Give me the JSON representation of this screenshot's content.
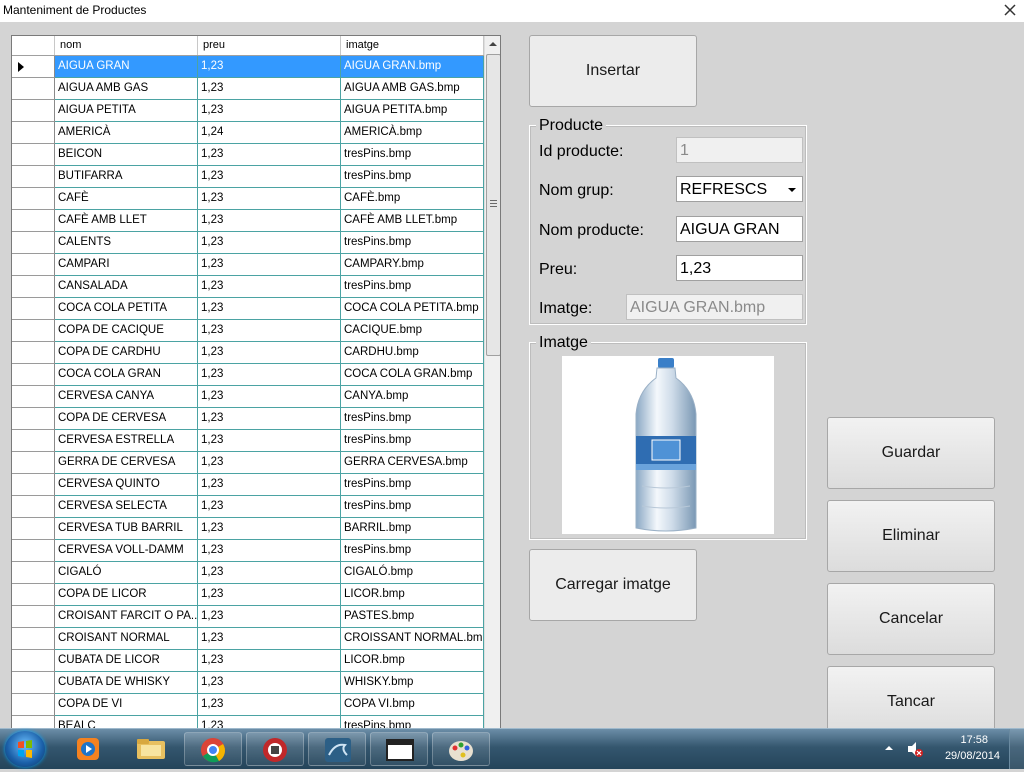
{
  "window": {
    "title": "Manteniment de Productes"
  },
  "grid": {
    "columns": [
      "nom",
      "preu",
      "imatge"
    ],
    "rows": [
      [
        "AIGUA GRAN",
        "1,23",
        "AIGUA GRAN.bmp"
      ],
      [
        "AIGUA AMB GAS",
        "1,23",
        "AIGUA AMB GAS.bmp"
      ],
      [
        "AIGUA PETITA",
        "1,23",
        "AIGUA PETITA.bmp"
      ],
      [
        "AMERICÀ",
        "1,24",
        "AMERICÀ.bmp"
      ],
      [
        "BEICON",
        "1,23",
        "tresPins.bmp"
      ],
      [
        "BUTIFARRA",
        "1,23",
        "tresPins.bmp"
      ],
      [
        "CAFÈ",
        "1,23",
        "CAFÈ.bmp"
      ],
      [
        "CAFÈ AMB LLET",
        "1,23",
        "CAFÈ AMB LLET.bmp"
      ],
      [
        "CALENTS",
        "1,23",
        "tresPins.bmp"
      ],
      [
        "CAMPARI",
        "1,23",
        "CAMPARY.bmp"
      ],
      [
        "CANSALADA",
        "1,23",
        "tresPins.bmp"
      ],
      [
        "COCA COLA PETITA",
        "1,23",
        "COCA COLA PETITA.bmp"
      ],
      [
        "COPA DE CACIQUE",
        "1,23",
        "CACIQUE.bmp"
      ],
      [
        "COPA DE CARDHU",
        "1,23",
        "CARDHU.bmp"
      ],
      [
        "COCA COLA GRAN",
        "1,23",
        "COCA COLA GRAN.bmp"
      ],
      [
        "CERVESA CANYA",
        "1,23",
        "CANYA.bmp"
      ],
      [
        "COPA DE CERVESA",
        "1,23",
        "tresPins.bmp"
      ],
      [
        "CERVESA ESTRELLA",
        "1,23",
        "tresPins.bmp"
      ],
      [
        "GERRA DE CERVESA",
        "1,23",
        "GERRA CERVESA.bmp"
      ],
      [
        "CERVESA QUINTO",
        "1,23",
        "tresPins.bmp"
      ],
      [
        "CERVESA SELECTA",
        "1,23",
        "tresPins.bmp"
      ],
      [
        "CERVESA TUB BARRIL",
        "1,23",
        "BARRIL.bmp"
      ],
      [
        "CERVESA VOLL-DAMM",
        "1,23",
        "tresPins.bmp"
      ],
      [
        "CIGALÓ",
        "1,23",
        "CIGALÓ.bmp"
      ],
      [
        "COPA DE LICOR",
        "1,23",
        "LICOR.bmp"
      ],
      [
        "CROISANT FARCIT O PA...",
        "1,23",
        "PASTES.bmp"
      ],
      [
        "CROISANT NORMAL",
        "1,23",
        "CROISSANT NORMAL.bmp"
      ],
      [
        "CUBATA DE LICOR",
        "1,23",
        "LICOR.bmp"
      ],
      [
        "CUBATA DE WHISKY",
        "1,23",
        "WHISKY.bmp"
      ],
      [
        "COPA DE VI",
        "1,23",
        "COPA VI.bmp"
      ],
      [
        "BEALC",
        "1,23",
        "tresPins.bmp"
      ]
    ],
    "selected_index": 0
  },
  "buttons": {
    "insertar": "Insertar",
    "carregar": "Carregar imatge",
    "guardar": "Guardar",
    "eliminar": "Eliminar",
    "cancelar": "Cancelar",
    "tancar": "Tancar"
  },
  "producte": {
    "group_title": "Producte",
    "id_label": "Id producte:",
    "id_value": "1",
    "grup_label": "Nom grup:",
    "grup_value": "REFRESCS",
    "nom_label": "Nom producte:",
    "nom_value": "AIGUA GRAN",
    "preu_label": "Preu:",
    "preu_value": "1,23",
    "imatge_label": "Imatge:",
    "imatge_value": "AIGUA GRAN.bmp"
  },
  "imatge_group": {
    "title": "Imatge",
    "image": "water-bottle-image"
  },
  "taskbar": {
    "time": "17:58",
    "date": "29/08/2014",
    "apps": [
      "media-player-icon",
      "explorer-icon",
      "chrome-icon",
      "app-icon",
      "mysql-workbench-icon",
      "window-app-icon",
      "paint-icon"
    ]
  },
  "colors": {
    "selection": "#3399ff",
    "grid_line": "#4ba3a3",
    "background": "#d4d4d4"
  }
}
